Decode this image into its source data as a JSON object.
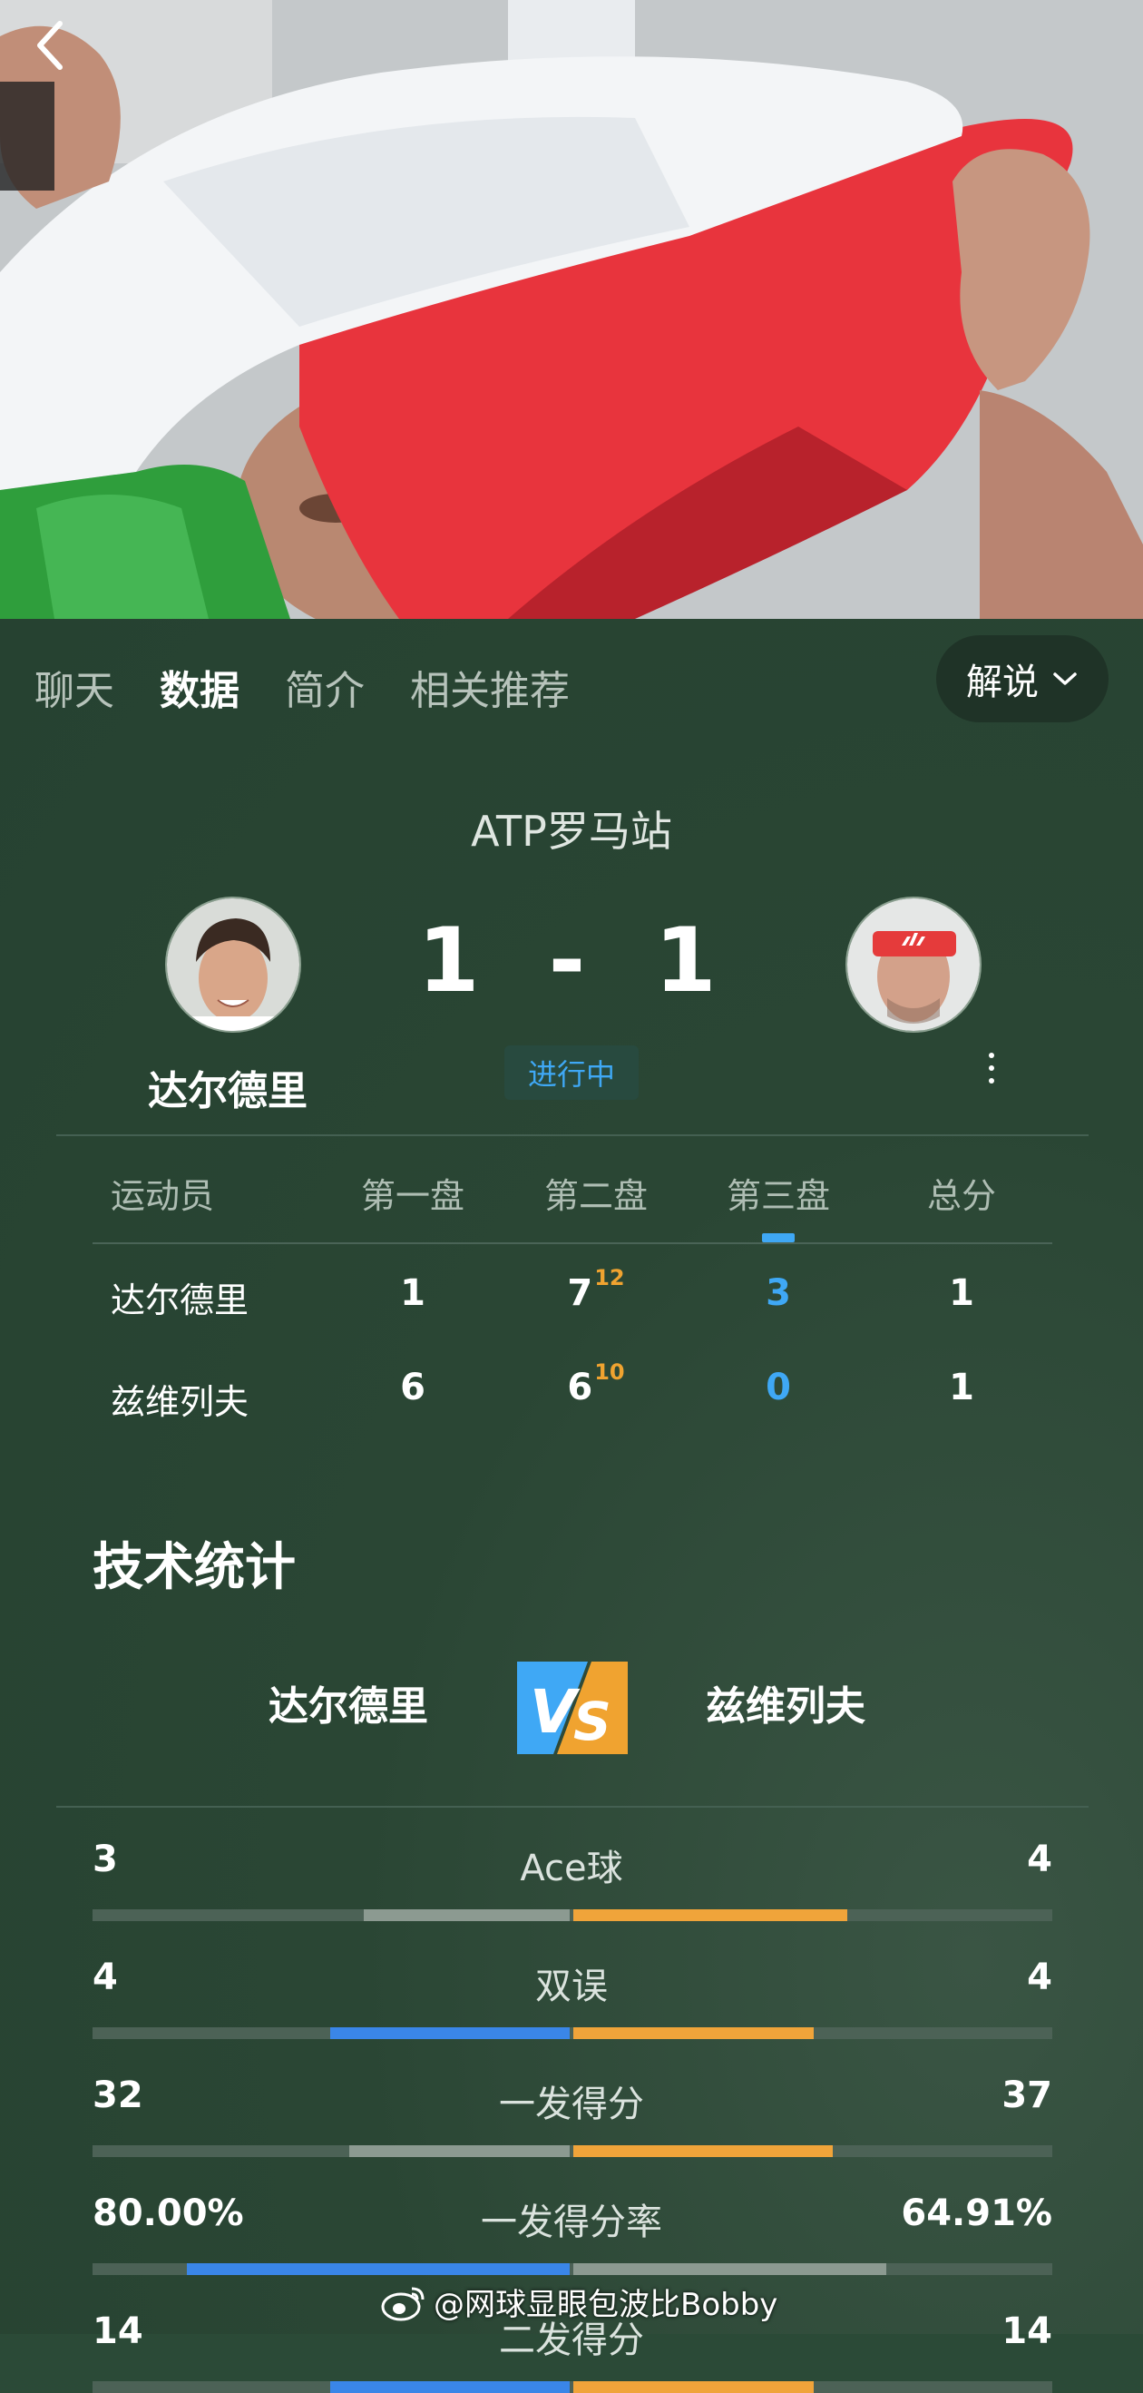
{
  "tabs": [
    "聊天",
    "数据",
    "简介",
    "相关推荐"
  ],
  "active_tab": 1,
  "commentary_label": "解说",
  "event": "ATP罗马站",
  "score": {
    "left": "1",
    "sep": "-",
    "right": "1"
  },
  "status": "进行中",
  "player_left": {
    "name": "达尔德里"
  },
  "player_right": {
    "name": "兹维列夫"
  },
  "score_table": {
    "headers": [
      "运动员",
      "第一盘",
      "第二盘",
      "第三盘",
      "总分"
    ],
    "rows": [
      {
        "name": "达尔德里",
        "s1": "1",
        "s2": "7",
        "s2_tb": "12",
        "s3": "3",
        "total": "1"
      },
      {
        "name": "兹维列夫",
        "s1": "6",
        "s2": "6",
        "s2_tb": "10",
        "s3": "0",
        "total": "1"
      }
    ]
  },
  "stats_title": "技术统计",
  "vs_left": "达尔德里",
  "vs_right": "兹维列夫",
  "stats": [
    {
      "label": "Ace球",
      "left": "3",
      "right": "4",
      "left_frac": 0.43,
      "right_frac": 0.57,
      "left_color": "#8c9a91",
      "right_color": "#f0a43a"
    },
    {
      "label": "双误",
      "left": "4",
      "right": "4",
      "left_frac": 0.5,
      "right_frac": 0.5,
      "left_color": "#3a86e8",
      "right_color": "#f0a43a"
    },
    {
      "label": "一发得分",
      "left": "32",
      "right": "37",
      "left_frac": 0.46,
      "right_frac": 0.54,
      "left_color": "#8c9a91",
      "right_color": "#f0a43a"
    },
    {
      "label": "一发得分率",
      "left": "80.00%",
      "right": "64.91%",
      "left_frac": 0.8,
      "right_frac": 0.65,
      "left_color": "#3a86e8",
      "right_color": "#8c9a91"
    },
    {
      "label": "二发得分",
      "left": "14",
      "right": "14",
      "left_frac": 0.5,
      "right_frac": 0.5,
      "left_color": "#3a86e8",
      "right_color": "#f0a43a"
    }
  ],
  "watermark": "@网球显眼包波比Bobby",
  "colors": {
    "accent_blue": "#3fa8f5",
    "accent_orange": "#f0a330",
    "panel_bg": "#2b4a37"
  }
}
